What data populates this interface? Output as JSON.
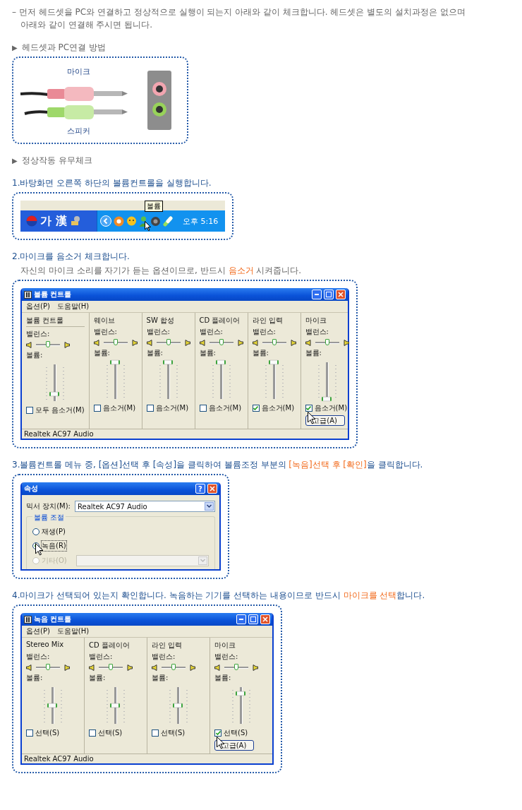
{
  "intro": [
    "– 먼저 헤드셋을 PC와 연결하고 정상적으로 실행이 되는지 아래와 같이 체크합니다. 헤드셋은 별도의 설치과정은 없으며",
    "아래와 같이 연결해 주시면 됩니다."
  ],
  "sections": [
    {
      "marker": "▶",
      "title": "헤드셋과 PC연결 방법",
      "figure": {
        "kind": "plugs",
        "top_label": "마이크",
        "bottom_label": "스피커"
      }
    },
    {
      "marker": "▶",
      "title": "정상작동 유무체크",
      "steps": [
        {
          "number": "1.",
          "title": [
            {
              "text": "바탕화면 오른쪽 하단의 볼륨컨트롤을 실행합니다.",
              "highlight": false
            }
          ],
          "screen": {
            "kind": "taskbar",
            "ime": "가 漢",
            "tooltip": "볼륨",
            "clock": "오후 5:16"
          }
        },
        {
          "number": "2.",
          "title": [
            {
              "text": "마이크를 음소거 체크합니다.",
              "highlight": false
            }
          ],
          "note": [
            {
              "text": "자신의 마이크 소리를 자기가 듣는 옵션이므로, 반드시 ",
              "highlight": false
            },
            {
              "text": "음소거",
              "highlight": true
            },
            {
              "text": " 시켜줍니다.",
              "highlight": false
            }
          ],
          "screen": {
            "kind": "mixer",
            "title": "볼륨 컨트롤",
            "menu": [
              "옵션(P)",
              "도움말(H)"
            ],
            "status": "Realtek AC97 Audio",
            "channels": [
              {
                "name": "볼륨 컨트롤",
                "balance": {
                  "label": "밸런스:",
                  "level": 0.5
                },
                "volume_label": "볼륨:",
                "level": 0.2,
                "check_label": "모두 음소거(M)",
                "checked": false
              },
              {
                "name": "웨이브",
                "balance": {
                  "label": "밸런스:",
                  "level": 0.5
                },
                "volume_label": "볼륨:",
                "level": 1,
                "check_label": "음소거(M)",
                "checked": false
              },
              {
                "name": "SW 합성",
                "balance": {
                  "label": "밸런스:",
                  "level": 0.5
                },
                "volume_label": "볼륨:",
                "level": 1,
                "check_label": "음소거(M)",
                "checked": false
              },
              {
                "name": "CD 플레이어",
                "balance": {
                  "label": "밸런스:",
                  "level": 0.5
                },
                "volume_label": "볼륨:",
                "level": 1,
                "check_label": "음소거(M)",
                "checked": false
              },
              {
                "name": "라인 입력",
                "balance": {
                  "label": "밸런스:",
                  "level": 0.5
                },
                "volume_label": "볼륨:",
                "level": 1,
                "check_label": "음소거(M)",
                "checked": true
              },
              {
                "name": "마이크",
                "balance": {
                  "label": "밸런스:",
                  "level": 0.5
                },
                "volume_label": "볼륨:",
                "level": 0,
                "check_label": "음소거(M)",
                "checked": true,
                "advanced_button": "고급(A)"
              }
            ]
          }
        },
        {
          "number": "3.",
          "title": [
            {
              "text": "볼륨컨트롤 메뉴 중, [옵션]선택 후 [속성]을 클릭하여 볼륨조정 부분의 ",
              "highlight": false
            },
            {
              "text": "[녹음]선택 후 [확인]",
              "highlight": true
            },
            {
              "text": "을 클릭합니다.",
              "highlight": false
            }
          ],
          "screen": {
            "kind": "properties",
            "title": "속성",
            "help_button": "?",
            "device_label": "믹서 장치(M):",
            "device": "Realtek AC97 Audio",
            "group": "볼륨 조절",
            "options": [
              {
                "label": "재생(P)",
                "selected": false,
                "disabled": false,
                "has_dropdown": false
              },
              {
                "label": "녹음(R)",
                "selected": true,
                "disabled": false,
                "has_dropdown": false
              },
              {
                "label": "기타(O)",
                "selected": false,
                "disabled": true,
                "has_dropdown": true
              }
            ]
          }
        },
        {
          "number": "4.",
          "title": [
            {
              "text": "마이크가 선택되어 있는지 확인합니다. 녹음하는 기기를 선택하는 내용이므로 반드시 ",
              "highlight": false
            },
            {
              "text": "마이크를 선택",
              "highlight": true
            },
            {
              "text": "합니다.",
              "highlight": false
            }
          ],
          "screen": {
            "kind": "mixer",
            "title": "녹음 컨트롤",
            "menu": [
              "옵션(P)",
              "도움말(H)"
            ],
            "status": "Realtek AC97 Audio",
            "channels": [
              {
                "name": "Stereo Mix",
                "balance": {
                  "label": "밸런스:",
                  "level": 0.5
                },
                "volume_label": "볼륨:",
                "level": 0.5,
                "check_label": "선택(S)",
                "checked": false
              },
              {
                "name": "CD 플레이어",
                "balance": {
                  "label": "밸런스:",
                  "level": 0.5
                },
                "volume_label": "볼륨:",
                "level": 0.5,
                "check_label": "선택(S)",
                "checked": false
              },
              {
                "name": "라인 입력",
                "balance": {
                  "label": "밸런스:",
                  "level": 0.5
                },
                "volume_label": "볼륨:",
                "level": 0.5,
                "check_label": "선택(S)",
                "checked": false
              },
              {
                "name": "마이크",
                "balance": {
                  "label": "밸런스:",
                  "level": 0.5
                },
                "volume_label": "볼륨:",
                "level": 0.82,
                "check_label": "선택(S)",
                "checked": true,
                "advanced_button": "고급(A)"
              }
            ]
          }
        }
      ]
    }
  ]
}
